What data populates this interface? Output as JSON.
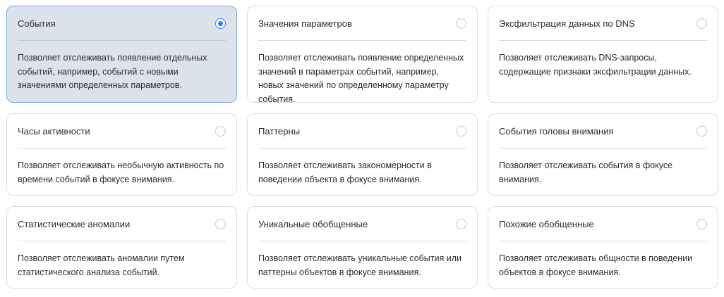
{
  "cards": [
    {
      "title": "События",
      "description": "Позволяет отслеживать появление отдельных событий, например, событий с новыми значениями определенных параметров.",
      "selected": true
    },
    {
      "title": "Значения параметров",
      "description": "Позволяет отслеживать появление определенных значений в параметрах событий, например, новых значений по определенному параметру события.",
      "selected": false
    },
    {
      "title": "Эксфильтрация данных по DNS",
      "description": "Позволяет отслеживать DNS-запросы, содержащие признаки эксфильтрации данных.",
      "selected": false
    },
    {
      "title": "Часы активности",
      "description": "Позволяет отслеживать необычную активность по времени событий в фокусе внимания.",
      "selected": false
    },
    {
      "title": "Паттерны",
      "description": "Позволяет отслеживать закономерности в поведении объекта в фокусе внимания.",
      "selected": false
    },
    {
      "title": "События головы внимания",
      "description": "Позволяет отслеживать события в фокусе внимания.",
      "selected": false
    },
    {
      "title": "Статистические аномалии",
      "description": "Позволяет отслеживать аномалии путем статистического анализа событий.",
      "selected": false
    },
    {
      "title": "Уникальные обобщенные",
      "description": "Позволяет отслеживать уникальные события или паттерны объектов в фокусе внимания.",
      "selected": false
    },
    {
      "title": "Похожие обобщенные",
      "description": "Позволяет отслеживать общности в поведении объектов в фокусе внимания.",
      "selected": false
    }
  ],
  "colors": {
    "selected_background": "#dde3ea",
    "selected_border": "#7aa6e6",
    "radio_accent": "#2f80ed",
    "card_border": "#d9dde3"
  }
}
